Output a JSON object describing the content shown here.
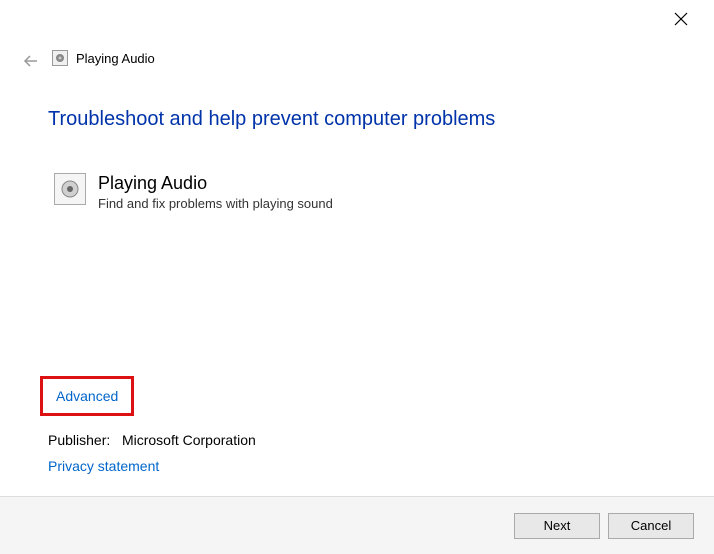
{
  "window": {
    "title": "Playing Audio"
  },
  "heading": "Troubleshoot and help prevent computer problems",
  "section": {
    "title": "Playing Audio",
    "description": "Find and fix problems with playing sound"
  },
  "advanced_link": "Advanced",
  "publisher_label": "Publisher:",
  "publisher_value": "Microsoft Corporation",
  "privacy_link": "Privacy statement",
  "buttons": {
    "next": "Next",
    "cancel": "Cancel"
  }
}
